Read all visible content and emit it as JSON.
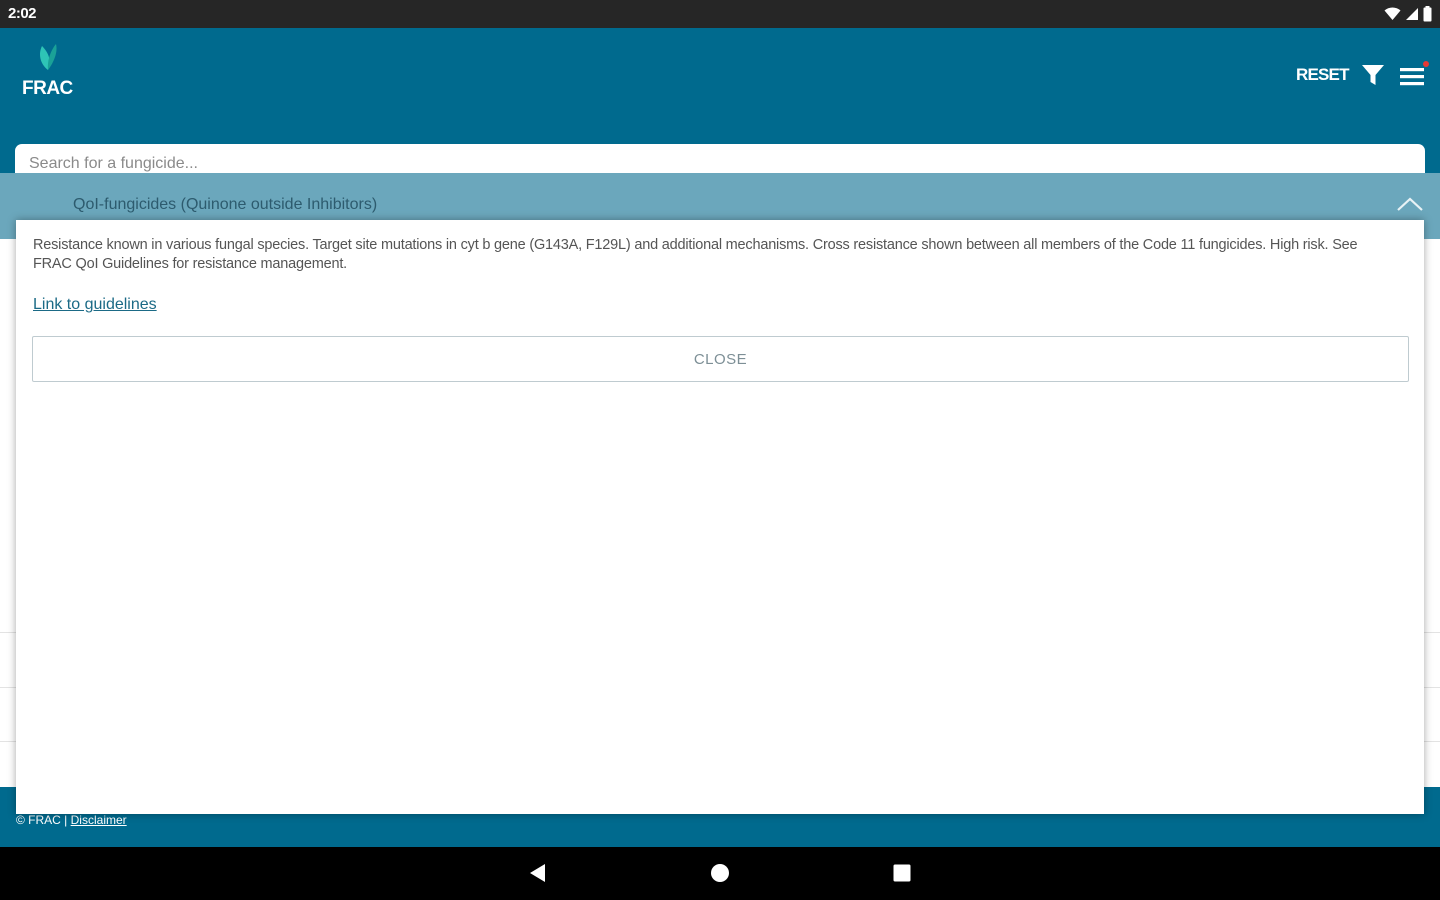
{
  "status_bar": {
    "time": "2:02",
    "icons": [
      "wifi-icon",
      "cell-signal-icon",
      "battery-icon"
    ]
  },
  "header": {
    "logo_text": "FRAC",
    "reset_label": "RESET",
    "filter_icon": "filter-icon",
    "menu_icon": "menu-icon",
    "menu_badge_color": "#e53935"
  },
  "search": {
    "placeholder": "Search for a fungicide...",
    "value": ""
  },
  "group": {
    "title": "QoI-fungicides (Quinone outside Inhibitors)",
    "expanded": true
  },
  "modal": {
    "description": "Resistance known in various fungal species. Target site mutations in cyt b gene (G143A, F129L) and additional mechanisms. Cross resistance shown between all members of the Code 11 fungicides. High risk. See FRAC QoI Guidelines for resistance management.",
    "link_label": "Link to guidelines",
    "close_label": "CLOSE"
  },
  "footer": {
    "copyright": "© FRAC |",
    "disclaimer_label": "Disclaimer"
  },
  "nav_bar": {
    "icons": [
      "back-icon",
      "home-icon",
      "recents-icon"
    ]
  },
  "colors": {
    "header_bg": "#006a8e",
    "group_bg": "#6ba7bc",
    "status_bar_bg": "#262626",
    "nav_bar_bg": "#000000",
    "logo_leaf": "#2ec4b6",
    "link": "#1b6a86"
  }
}
